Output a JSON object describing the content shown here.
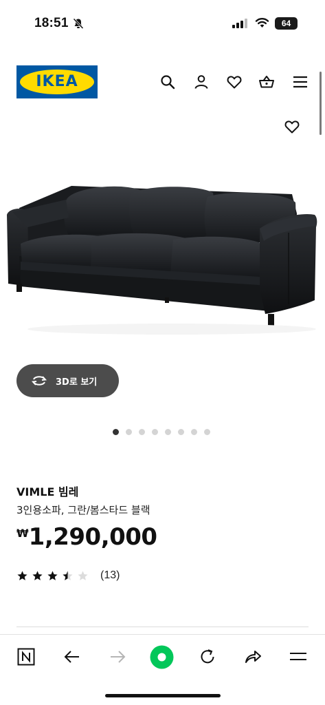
{
  "status_bar": {
    "time": "18:51",
    "battery": "64"
  },
  "header": {
    "logo_text": "IKEA",
    "icons": [
      "search-icon",
      "user-icon",
      "heart-icon",
      "basket-icon",
      "menu-icon"
    ]
  },
  "gallery": {
    "view_3d_label": "3D로 보기",
    "image_count": 8,
    "active_index": 0
  },
  "product": {
    "name": "VIMLE 빔레",
    "description": "3인용소파, 그란/봄스타드 블랙",
    "currency": "₩",
    "price": "1,290,000",
    "rating": 3.5,
    "rating_max": 5,
    "review_count": "(13)"
  },
  "toolbar": {
    "icons": [
      "n-tab-icon",
      "back-arrow-icon",
      "forward-arrow-icon",
      "green-dot-icon",
      "reload-icon",
      "share-icon",
      "menu-icon"
    ]
  },
  "colors": {
    "ikea_blue": "#0058a3",
    "ikea_yellow": "#ffdb00",
    "naver_green": "#03c75a",
    "button_3d": "#4c4c4c"
  }
}
